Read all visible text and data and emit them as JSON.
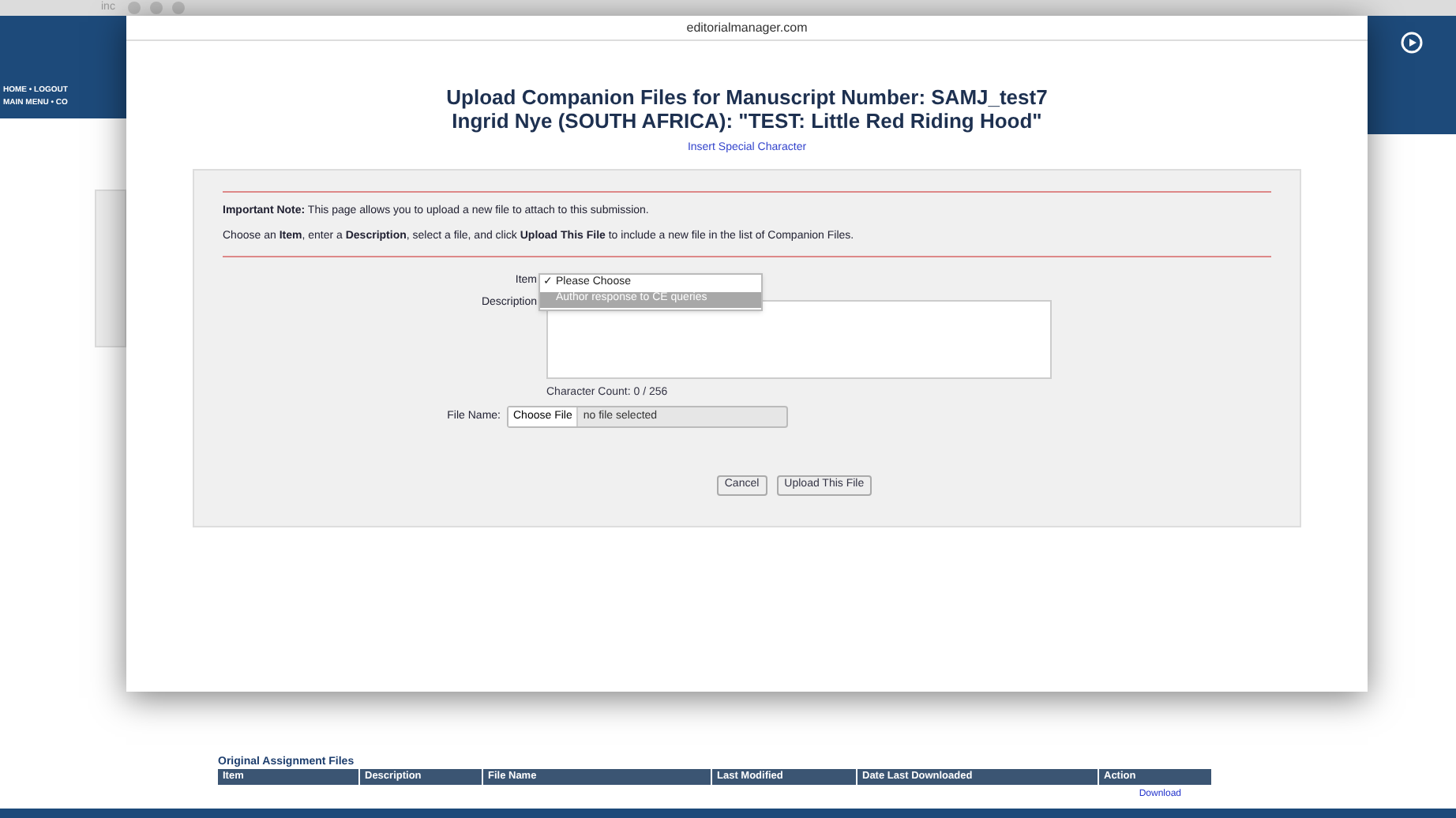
{
  "background": {
    "tab_text": "inc",
    "nav_links": [
      "HOME • LOGOUT",
      "MAIN MENU • CO"
    ],
    "files_title": "Original Assignment Files",
    "columns": [
      "Item",
      "Description",
      "File Name",
      "Last Modified",
      "Date  Last Downloaded",
      "Action"
    ],
    "row_action": "Download"
  },
  "dialog": {
    "url": "editorialmanager.com",
    "title_lines": [
      "Upload Companion Files for Manuscript Number: SAMJ_test7",
      "Ingrid Nye (SOUTH AFRICA): \"TEST: Little Red Riding Hood\""
    ],
    "special_char_link": "Insert Special Character",
    "note": "**Important Note:** This page allows you to upload a new file to attach to this submission.",
    "instructions": "Choose an **Item**, enter a **Description**, select a file, and click **Upload This File** to include a new file in the list of Companion Files.",
    "item_label": "Item",
    "check_mark": "✓",
    "item_options": [
      {
        "label": "Please Choose",
        "checked": true,
        "selected": false
      },
      {
        "label": "Author response to CE queries",
        "checked": false,
        "selected": true
      }
    ],
    "description_label": "Description",
    "character_count": "Character Count: 0 / 256",
    "file_label": "File Name:",
    "choose_file": "Choose File",
    "file_status": "no file selected",
    "buttons": [
      "Cancel",
      "Upload This File"
    ]
  }
}
